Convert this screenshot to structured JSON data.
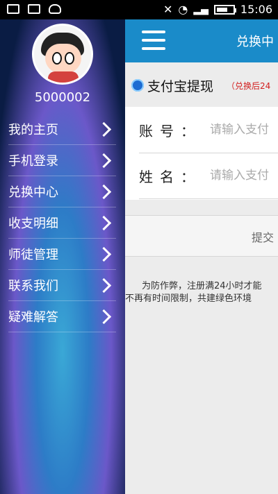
{
  "status_bar": {
    "time": "15:06",
    "icons": [
      "image-icon",
      "mail-icon",
      "cat-icon",
      "mute-icon",
      "wifi-icon",
      "signal-icon",
      "battery-icon"
    ]
  },
  "sidebar": {
    "user_id": "5000002",
    "items": [
      {
        "label": "我的主页"
      },
      {
        "label": "手机登录"
      },
      {
        "label": "兑换中心"
      },
      {
        "label": "收支明细"
      },
      {
        "label": "师徒管理"
      },
      {
        "label": "联系我们"
      },
      {
        "label": "疑难解答"
      }
    ]
  },
  "main": {
    "title": "兑换中",
    "alipay": {
      "title": "支付宝提现",
      "note": "（兑换后24"
    },
    "form": {
      "account_label": "账号：",
      "account_placeholder": "请输入支付",
      "name_label": "姓名：",
      "name_placeholder": "请输入支付"
    },
    "submit_label": "提交",
    "notice_line1": "为防作弊，注册满24小时才能",
    "notice_line2": "不再有时间限制，共建绿色环境"
  },
  "colors": {
    "topbar": "#1a8bc9",
    "note_red": "#d21e1e"
  }
}
